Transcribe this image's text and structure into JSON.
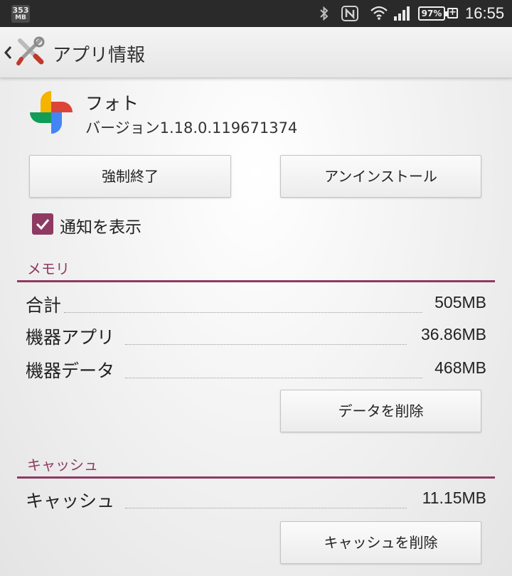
{
  "status_bar": {
    "memory_value": "353",
    "memory_unit": "MB",
    "battery": "97%",
    "time": "16:55"
  },
  "action_bar": {
    "title": "アプリ情報"
  },
  "app": {
    "name": "フォト",
    "version": "バージョン1.18.0.119671374"
  },
  "buttons": {
    "force_stop": "強制終了",
    "uninstall": "アンインストール",
    "clear_data": "データを削除",
    "clear_cache": "キャッシュを削除"
  },
  "notification": {
    "label": "通知を表示",
    "checked": true
  },
  "memory": {
    "title": "メモリ",
    "rows": [
      {
        "label": "合計",
        "value": "505MB"
      },
      {
        "label": "機器アプリ",
        "value": "36.86MB"
      },
      {
        "label": "機器データ",
        "value": "468MB"
      }
    ]
  },
  "cache": {
    "title": "キャッシュ",
    "rows": [
      {
        "label": "キャッシュ",
        "value": "11.15MB"
      }
    ]
  },
  "colors": {
    "accent": "#8e3a62",
    "status_bar": "#2a2a2a"
  }
}
